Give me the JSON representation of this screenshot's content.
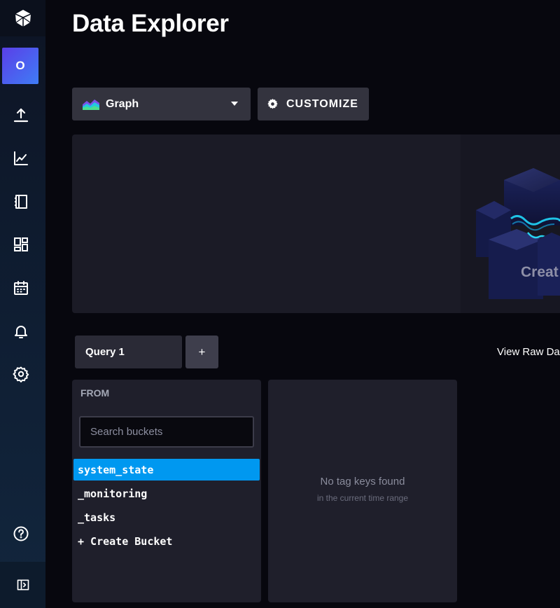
{
  "sidebar": {
    "logo_icon": "influxdb-cube-icon",
    "org_initial": "O",
    "items": [
      {
        "icon": "upload-icon"
      },
      {
        "icon": "graph-icon"
      },
      {
        "icon": "notebook-icon"
      },
      {
        "icon": "dashboards-icon"
      },
      {
        "icon": "calendar-icon"
      },
      {
        "icon": "bell-icon"
      },
      {
        "icon": "gear-icon"
      }
    ],
    "help_icon": "help-icon",
    "collapse_icon": "collapse-sidebar-icon"
  },
  "header": {
    "title": "Data Explorer"
  },
  "toolbar": {
    "visualization": "Graph",
    "customize_label": "CUSTOMIZE"
  },
  "graph": {
    "empty_state_text": "Creat"
  },
  "query": {
    "tabs": [
      {
        "label": "Query 1"
      }
    ],
    "add_label": "+",
    "view_raw_label": "View Raw Da"
  },
  "from": {
    "header": "FROM",
    "search_placeholder": "Search buckets",
    "buckets": [
      {
        "name": "system_state",
        "selected": true
      },
      {
        "name": "_monitoring",
        "selected": false
      },
      {
        "name": "_tasks",
        "selected": false
      },
      {
        "name": "+ Create Bucket",
        "selected": false
      }
    ]
  },
  "tag_keys": {
    "empty_title": "No tag keys found",
    "empty_subtitle": "in the current time range"
  },
  "colors": {
    "accent": "#0098f0",
    "org_gradient_start": "#5a3fe8",
    "org_gradient_end": "#3f7cf5",
    "panel_bg": "#1f1f2b",
    "page_bg": "#07070e"
  }
}
